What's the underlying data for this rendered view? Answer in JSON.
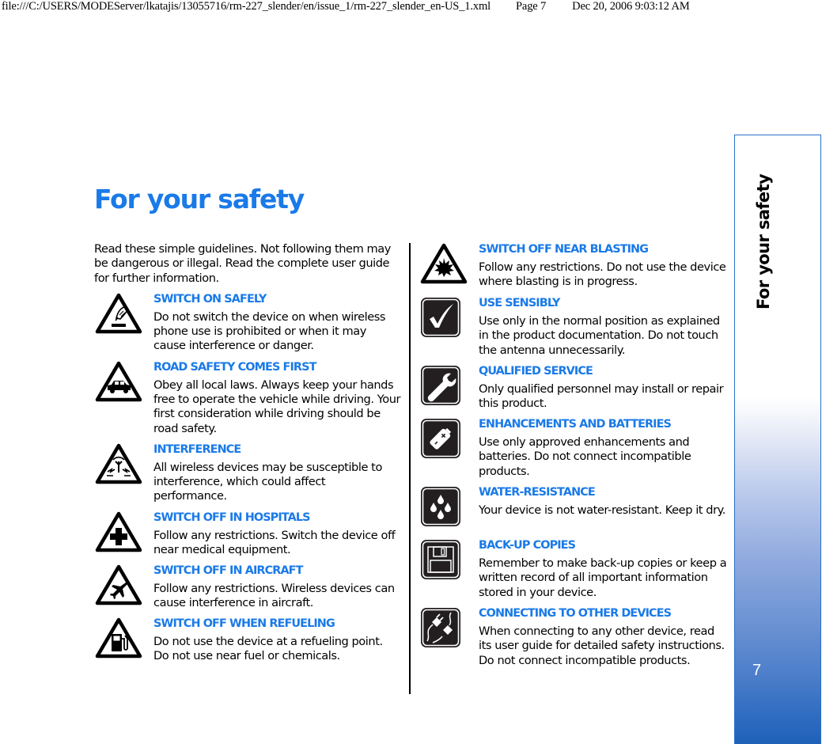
{
  "print_header": {
    "path": "file:///C:/USERS/MODEServer/lkatajis/13055716/rm-227_slender/en/issue_1/rm-227_slender_en-US_1.xml",
    "page": "Page 7",
    "datetime": "Dec 20, 2006 9:03:12 AM"
  },
  "page": {
    "title": "For your safety",
    "intro": "Read these simple guidelines. Not following them may be dangerous or illegal. Read the complete user guide for further information.",
    "accent_color": "#1a7ae8"
  },
  "left_column": [
    {
      "icon": "switch-on-warning-icon",
      "title": "SWITCH ON SAFELY",
      "body": "Do not switch the device on when wireless phone use is prohibited or when it may cause interference or danger."
    },
    {
      "icon": "car-warning-icon",
      "title": "ROAD SAFETY COMES FIRST",
      "body": "Obey all local laws. Always keep your hands free to operate the vehicle while driving. Your first consideration while driving should be road safety."
    },
    {
      "icon": "interference-warning-icon",
      "title": "INTERFERENCE",
      "body": "All wireless devices may be susceptible to interference, which could affect performance."
    },
    {
      "icon": "hospital-cross-warning-icon",
      "title": "SWITCH OFF IN HOSPITALS",
      "body": "Follow any restrictions. Switch the device off near medical equipment."
    },
    {
      "icon": "aircraft-warning-icon",
      "title": "SWITCH OFF IN AIRCRAFT",
      "body": "Follow any restrictions. Wireless devices can cause interference in aircraft."
    },
    {
      "icon": "fuel-pump-warning-icon",
      "title": "SWITCH OFF WHEN REFUELING",
      "body": "Do not use the device at a refueling point. Do not use near fuel or chemicals."
    }
  ],
  "right_column": [
    {
      "icon": "blasting-warning-icon",
      "title": "SWITCH OFF NEAR BLASTING",
      "body": "Follow any restrictions. Do not use the device where blasting is in progress."
    },
    {
      "icon": "checkmark-icon",
      "title": "USE SENSIBLY",
      "body": "Use only in the normal position as explained in the product documentation. Do not touch the antenna unnecessarily."
    },
    {
      "icon": "wrench-icon",
      "title": "QUALIFIED SERVICE",
      "body": "Only qualified personnel may install or repair this product."
    },
    {
      "icon": "battery-icon",
      "title": "ENHANCEMENTS AND BATTERIES",
      "body": "Use only approved enhancements and batteries. Do not connect incompatible products."
    },
    {
      "icon": "water-drops-icon",
      "title": "WATER-RESISTANCE",
      "body": "Your device is not water-resistant. Keep it dry."
    },
    {
      "icon": "floppy-disk-icon",
      "title": "BACK-UP COPIES",
      "body": "Remember to make back-up copies or keep a written record of all important information stored in your device."
    },
    {
      "icon": "plug-connector-icon",
      "title": "CONNECTING TO OTHER DEVICES",
      "body": "When connecting to any other device, read its user guide for detailed safety instructions. Do not connect incompatible products."
    }
  ],
  "side_tab": {
    "label": "For your safety",
    "page_number": "7"
  }
}
